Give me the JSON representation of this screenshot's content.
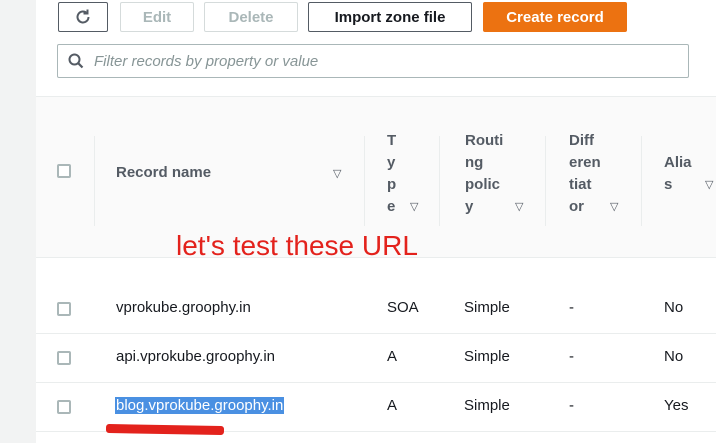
{
  "toolbar": {
    "edit_label": "Edit",
    "delete_label": "Delete",
    "import_label": "Import zone file",
    "create_label": "Create record"
  },
  "search": {
    "placeholder": "Filter records by property or value"
  },
  "table": {
    "headers": {
      "record_name": "Record name",
      "type": "T y p e",
      "routing_policy": "Routi ng polic y",
      "differentiator": "Diff eren tiat or",
      "alias": "Alia s"
    },
    "rows": [
      {
        "name": "vprokube.groophy.in",
        "type": "SOA",
        "routing": "Simple",
        "diff": "-",
        "alias": "No"
      },
      {
        "name": "api.vprokube.groophy.in",
        "type": "A",
        "routing": "Simple",
        "diff": "-",
        "alias": "No"
      },
      {
        "name": "blog.vprokube.groophy.in",
        "type": "A",
        "routing": "Simple",
        "diff": "-",
        "alias": "Yes"
      }
    ]
  },
  "annotation": {
    "text": "let's test these URL",
    "color": "#e3221c"
  },
  "colors": {
    "primary": "#ec7211",
    "selection": "#4a90e2"
  }
}
